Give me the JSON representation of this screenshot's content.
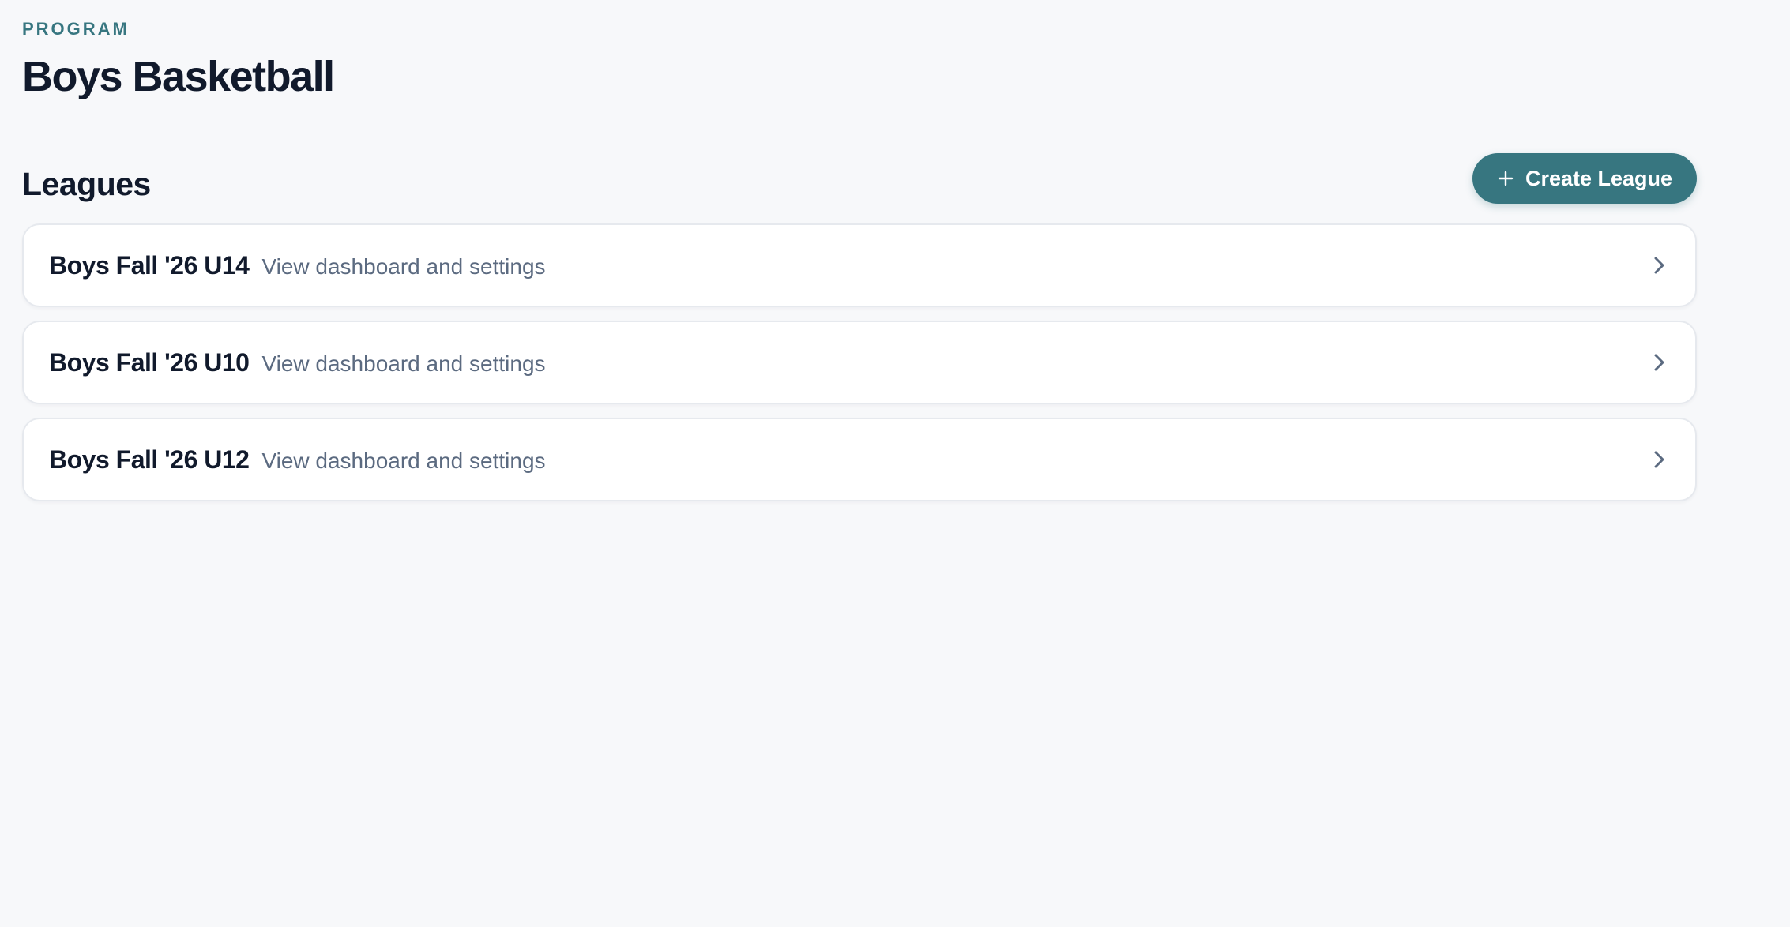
{
  "header": {
    "eyebrow": "PROGRAM",
    "title": "Boys Basketball"
  },
  "leagues_section": {
    "title": "Leagues",
    "create_button_label": "Create League",
    "create_button_icon": "plus-icon"
  },
  "leagues": [
    {
      "name": "Boys Fall '26 U14",
      "subtitle": "View dashboard and settings",
      "icon": "chevron-right-icon"
    },
    {
      "name": "Boys Fall '26 U10",
      "subtitle": "View dashboard and settings",
      "icon": "chevron-right-icon"
    },
    {
      "name": "Boys Fall '26 U12",
      "subtitle": "View dashboard and settings",
      "icon": "chevron-right-icon"
    }
  ],
  "colors": {
    "accent": "#377680",
    "background": "#f7f8fa",
    "text_primary": "#111a2c",
    "text_secondary": "#5b6a80"
  }
}
